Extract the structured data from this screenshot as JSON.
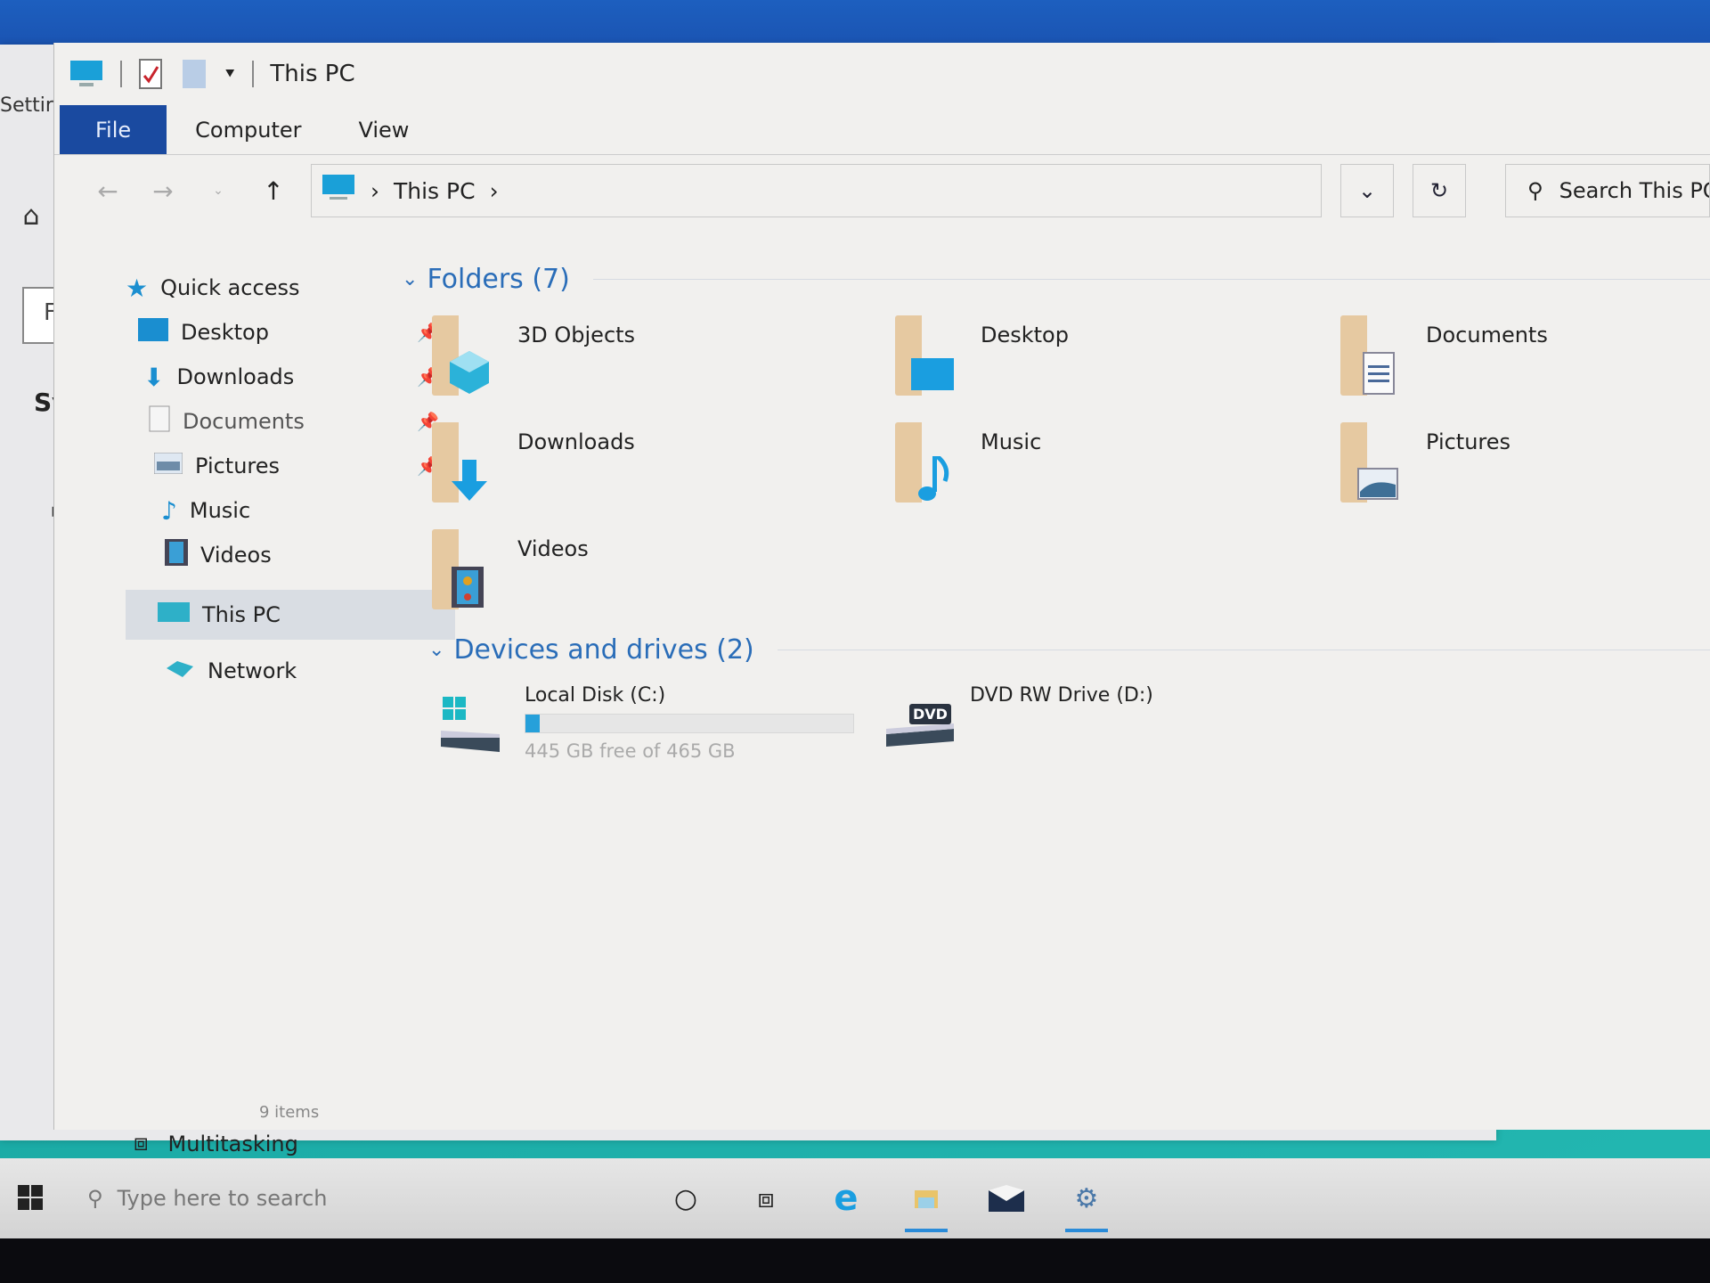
{
  "settings": {
    "title_fragment": "Settir",
    "find_fragment": "Fi",
    "section_fragment": "Syst",
    "bottom_item": "Multitasking",
    "rail_icons": [
      "home-icon",
      "display-icon",
      "sound-icon",
      "notifications-icon",
      "focus-assist-icon",
      "power-icon",
      "battery-icon",
      "storage-icon",
      "tablet-icon"
    ]
  },
  "explorer": {
    "title": "This PC",
    "quick_access_toolbar": [
      "computer-icon",
      "properties-icon",
      "new-folder-icon",
      "customize-qat-icon"
    ],
    "ribbon_tabs": [
      {
        "label": "File",
        "active": true
      },
      {
        "label": "Computer",
        "active": false
      },
      {
        "label": "View",
        "active": false
      }
    ],
    "address": {
      "breadcrumb": [
        "This PC"
      ],
      "search_placeholder": "Search This PC"
    },
    "nav_pane": {
      "quick_access_label": "Quick access",
      "quick_access_items": [
        {
          "label": "Desktop",
          "pinned": true,
          "icon": "desktop-icon"
        },
        {
          "label": "Downloads",
          "pinned": true,
          "icon": "download-icon"
        },
        {
          "label": "Documents",
          "pinned": true,
          "icon": "documents-icon"
        },
        {
          "label": "Pictures",
          "pinned": true,
          "icon": "pictures-icon"
        },
        {
          "label": "Music",
          "pinned": false,
          "icon": "music-icon"
        },
        {
          "label": "Videos",
          "pinned": false,
          "icon": "videos-icon"
        }
      ],
      "this_pc_label": "This PC",
      "network_label": "Network"
    },
    "folders_group": {
      "header": "Folders (7)",
      "items": [
        {
          "name": "3D Objects",
          "icon": "3d-objects-icon"
        },
        {
          "name": "Desktop",
          "icon": "desktop-icon"
        },
        {
          "name": "Documents",
          "icon": "documents-icon"
        },
        {
          "name": "Downloads",
          "icon": "download-icon"
        },
        {
          "name": "Music",
          "icon": "music-icon"
        },
        {
          "name": "Pictures",
          "icon": "pictures-icon"
        },
        {
          "name": "Videos",
          "icon": "videos-icon"
        }
      ]
    },
    "drives_group": {
      "header": "Devices and drives (2)",
      "items": [
        {
          "name": "Local Disk (C:)",
          "free_text": "445 GB free of 465 GB",
          "used_fraction": 0.043,
          "icon": "windows-drive-icon"
        },
        {
          "name": "DVD RW Drive (D:)",
          "icon": "dvd-drive-icon",
          "badge": "DVD"
        }
      ]
    },
    "status": "9 items"
  },
  "taskbar": {
    "search_placeholder": "Type here to search",
    "icons": [
      {
        "name": "cortana-icon",
        "active": false
      },
      {
        "name": "task-view-icon",
        "active": false
      },
      {
        "name": "edge-icon",
        "active": false
      },
      {
        "name": "file-explorer-icon",
        "active": true
      },
      {
        "name": "mail-icon",
        "active": false
      },
      {
        "name": "settings-icon",
        "active": true
      }
    ]
  },
  "colors": {
    "accent": "#1a4aa0",
    "group_header": "#2a6db8",
    "icon_blue": "#26a0da",
    "folder_tan": "#e6c9a1",
    "desktop_teal": "#19a8a3"
  }
}
